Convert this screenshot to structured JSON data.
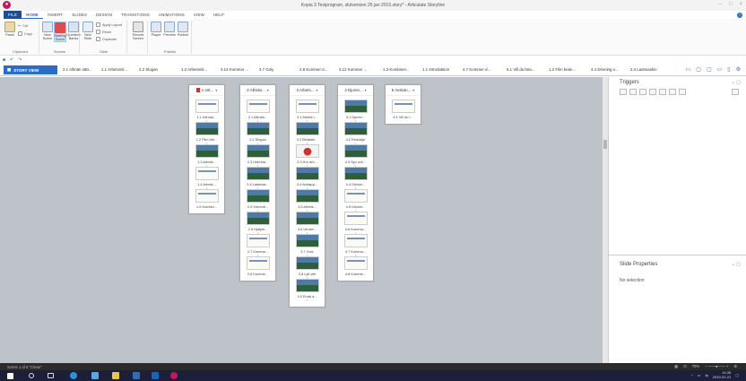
{
  "window": {
    "title": "Kopia 3 Testprogram, slutversion 25 jan 2015.story* - Articulate Storyline",
    "controls": [
      "–",
      "□",
      "×"
    ]
  },
  "ribbon_tabs": [
    "FILE",
    "HOME",
    "INSERT",
    "SLIDES",
    "DESIGN",
    "TRANSITIONS",
    "ANIMATIONS",
    "VIEW",
    "HELP"
  ],
  "ribbon": {
    "clipboard": {
      "cut": "Cut",
      "copy": "Copy",
      "paste": "Paste",
      "label": "Clipboard"
    },
    "scenes": {
      "new_scene": "New Scene",
      "starting_scene": "Starting Scene",
      "question_banks": "Question Banks",
      "label": "Scenes"
    },
    "slide": {
      "new_slide": "New Slide",
      "apply_layout": "Apply Layout",
      "reset": "Reset",
      "duplicate": "Duplicate",
      "label": "Slide"
    },
    "record": {
      "record_screen": "Record Screen"
    },
    "publish": {
      "player": "Player",
      "preview": "Preview",
      "publish": "Publish",
      "label": "Publish"
    }
  },
  "scene_tabs": {
    "story_view": "STORY VIEW",
    "tabs": [
      "2.1 Allmän sätt...",
      "1.1 Arbetsmil...",
      "2.2 Slogan",
      "1.2 Arbetsmil...",
      "3.14 Kommer ...",
      "3.7 Goly",
      "2.8 Kommer d...",
      "3.12 Kommer ...",
      "1.3 Kombiner...",
      "1.1 Introduktion",
      "4.7 Kommer d...",
      "5.1 Vill du lära...",
      "1.2 Film betei...",
      "4.4 Drivning o...",
      "2.4 Lastmaskin"
    ]
  },
  "scenes": [
    {
      "title": "1 Intr...",
      "flag": true,
      "slides": [
        "1.1 Introdu...",
        "1.2 Film bet...",
        "1.3 Arbets...",
        "1.4 Arbets...",
        "1.5 Kombin..."
      ],
      "thumbs": [
        "doc",
        "photo",
        "photo",
        "doc",
        "doc"
      ]
    },
    {
      "title": "2 Allmän...",
      "flag": false,
      "slides": [
        "2.1 Allmän...",
        "2.2 Slogan",
        "2.3 Hobrina...",
        "2.4 Lastmas...",
        "2.5 Kommit...",
        "2.6 Hjälpm...",
        "2.7 Komma...",
        "2.8 Komme..."
      ],
      "thumbs": [
        "doc",
        "photo",
        "photo",
        "photo",
        "photo",
        "photo",
        "doc",
        "doc"
      ]
    },
    {
      "title": "3 Arbets...",
      "flag": false,
      "slides": [
        "3.1 Arbets r...",
        "3.2 Belastni...",
        "3.3 Hur arb...",
        "3.4 Avlaspp...",
        "3.5 Arbets...",
        "3.6 Utrusn...",
        "3.7 Golv",
        "3.8 Lyft vikt",
        "3.9 Enda a..."
      ],
      "thumbs": [
        "doc",
        "photo",
        "red",
        "photo",
        "photo",
        "photo",
        "photo",
        "photo",
        "photo"
      ]
    },
    {
      "title": "4 Djuren...",
      "flag": false,
      "slides": [
        "4.1 Djuren...",
        "4.2 Reduktje",
        "4.3 Syn och...",
        "4.4 Drivnin...",
        "4.5 Drivnin...",
        "4.6 Komma...",
        "4.7 Komma...",
        "4.8 Komme..."
      ],
      "thumbs": [
        "photo",
        "photo",
        "photo",
        "photo",
        "doc",
        "doc",
        "doc",
        "doc"
      ]
    },
    {
      "title": "5 Avslutn...",
      "flag": false,
      "slides": [
        "5.1 Vill du l..."
      ],
      "thumbs": [
        "doc"
      ]
    }
  ],
  "panels": {
    "triggers": "Triggers",
    "slide_properties": "Slide Properties",
    "no_selection": "No selection"
  },
  "status": {
    "scene": "Scene 1 of 5  \"Clean\"",
    "zoom": "70%"
  },
  "taskbar": {
    "time": "14:35",
    "date": "2019-02-21"
  },
  "colors": {
    "accent": "#2b6cc4",
    "file_tab": "#1e4e8c",
    "canvas": "#bec3c9",
    "flag": "#d32f2f",
    "taskbar": "#1b1f3a"
  }
}
